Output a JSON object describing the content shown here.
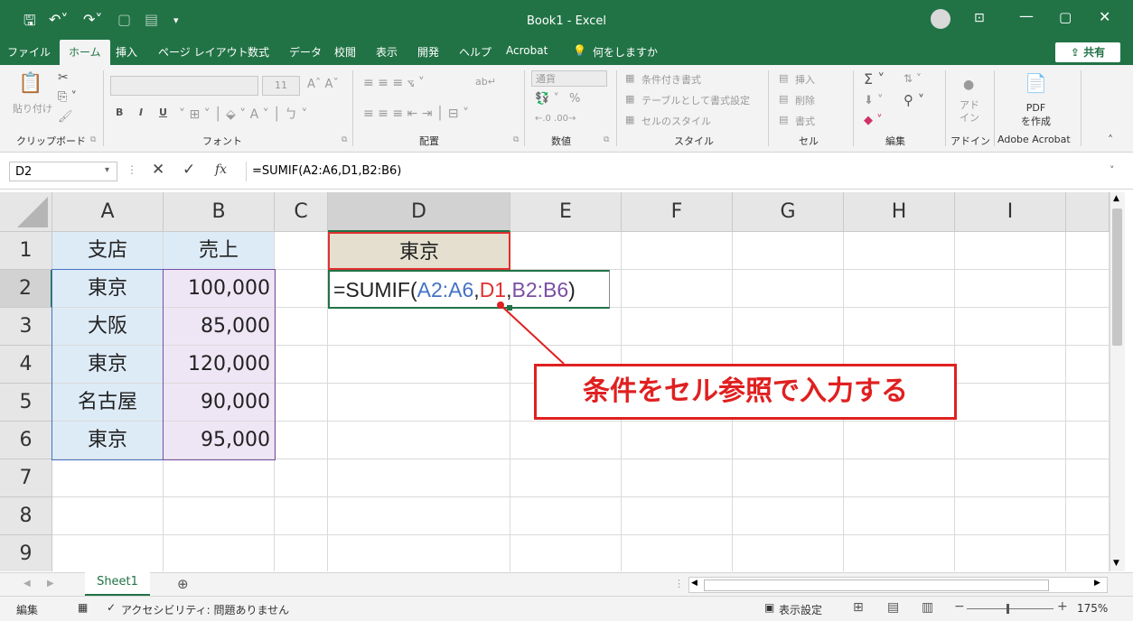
{
  "window": {
    "title": "Book1  -  Excel"
  },
  "tabs": [
    "ファイル",
    "ホーム",
    "挿入",
    "ページ レイアウト",
    "数式",
    "データ",
    "校閲",
    "表示",
    "開発",
    "ヘルプ",
    "Acrobat"
  ],
  "tell_me": "何をしますか",
  "share_label": "共有",
  "ribbon": {
    "clipboard": {
      "paste": "貼り付け",
      "label": "クリップボード"
    },
    "font": {
      "size": "11",
      "bold": "B",
      "italic": "I",
      "underline": "U",
      "label": "フォント"
    },
    "alignment": {
      "label": "配置"
    },
    "number": {
      "format": "通貨",
      "percent": "%",
      "label": "数値"
    },
    "styles": {
      "conditional": "条件付き書式",
      "table": "テーブルとして書式設定",
      "cell": "セルのスタイル",
      "label": "スタイル"
    },
    "cells": {
      "insert": "挿入",
      "delete": "削除",
      "format": "書式",
      "label": "セル"
    },
    "editing": {
      "label": "編集"
    },
    "addins": {
      "name": "アド\nイン",
      "label": "アドイン"
    },
    "acrobat": {
      "name": "PDF\nを作成",
      "label": "Adobe Acrobat"
    }
  },
  "formula_bar": {
    "name_box": "D2",
    "fx": "fx",
    "formula": "=SUMIF(A2:A6,D1,B2:B6)"
  },
  "columns": [
    "A",
    "B",
    "C",
    "D",
    "E",
    "F",
    "G",
    "H",
    "I"
  ],
  "rows": [
    "1",
    "2",
    "3",
    "4",
    "5",
    "6",
    "7",
    "8",
    "9"
  ],
  "cells": {
    "A1": "支店",
    "B1": "売上",
    "D1": "東京",
    "A2": "東京",
    "B2": "100,000",
    "A3": "大阪",
    "B3": "85,000",
    "A4": "東京",
    "B4": "120,000",
    "A5": "名古屋",
    "B5": "90,000",
    "A6": "東京",
    "B6": "95,000"
  },
  "edit_formula": {
    "eq": "=SUMIF(",
    "ref1": "A2:A6",
    "c1": ",",
    "ref2": "D1",
    "c2": ",",
    "ref3": "B2:B6",
    "close": ")"
  },
  "callout": "条件をセル参照で入力する",
  "sheet_tab": "Sheet1",
  "status": {
    "mode": "編集",
    "accessibility": "アクセシビリティ: 問題ありません",
    "display": "表示設定",
    "zoom": "175%"
  },
  "colors": {
    "excel_green": "#217346",
    "ref_blue": "#4472c4",
    "ref_red": "#e03030",
    "ref_purple": "#7b4ea3",
    "callout_red": "#e02020"
  }
}
